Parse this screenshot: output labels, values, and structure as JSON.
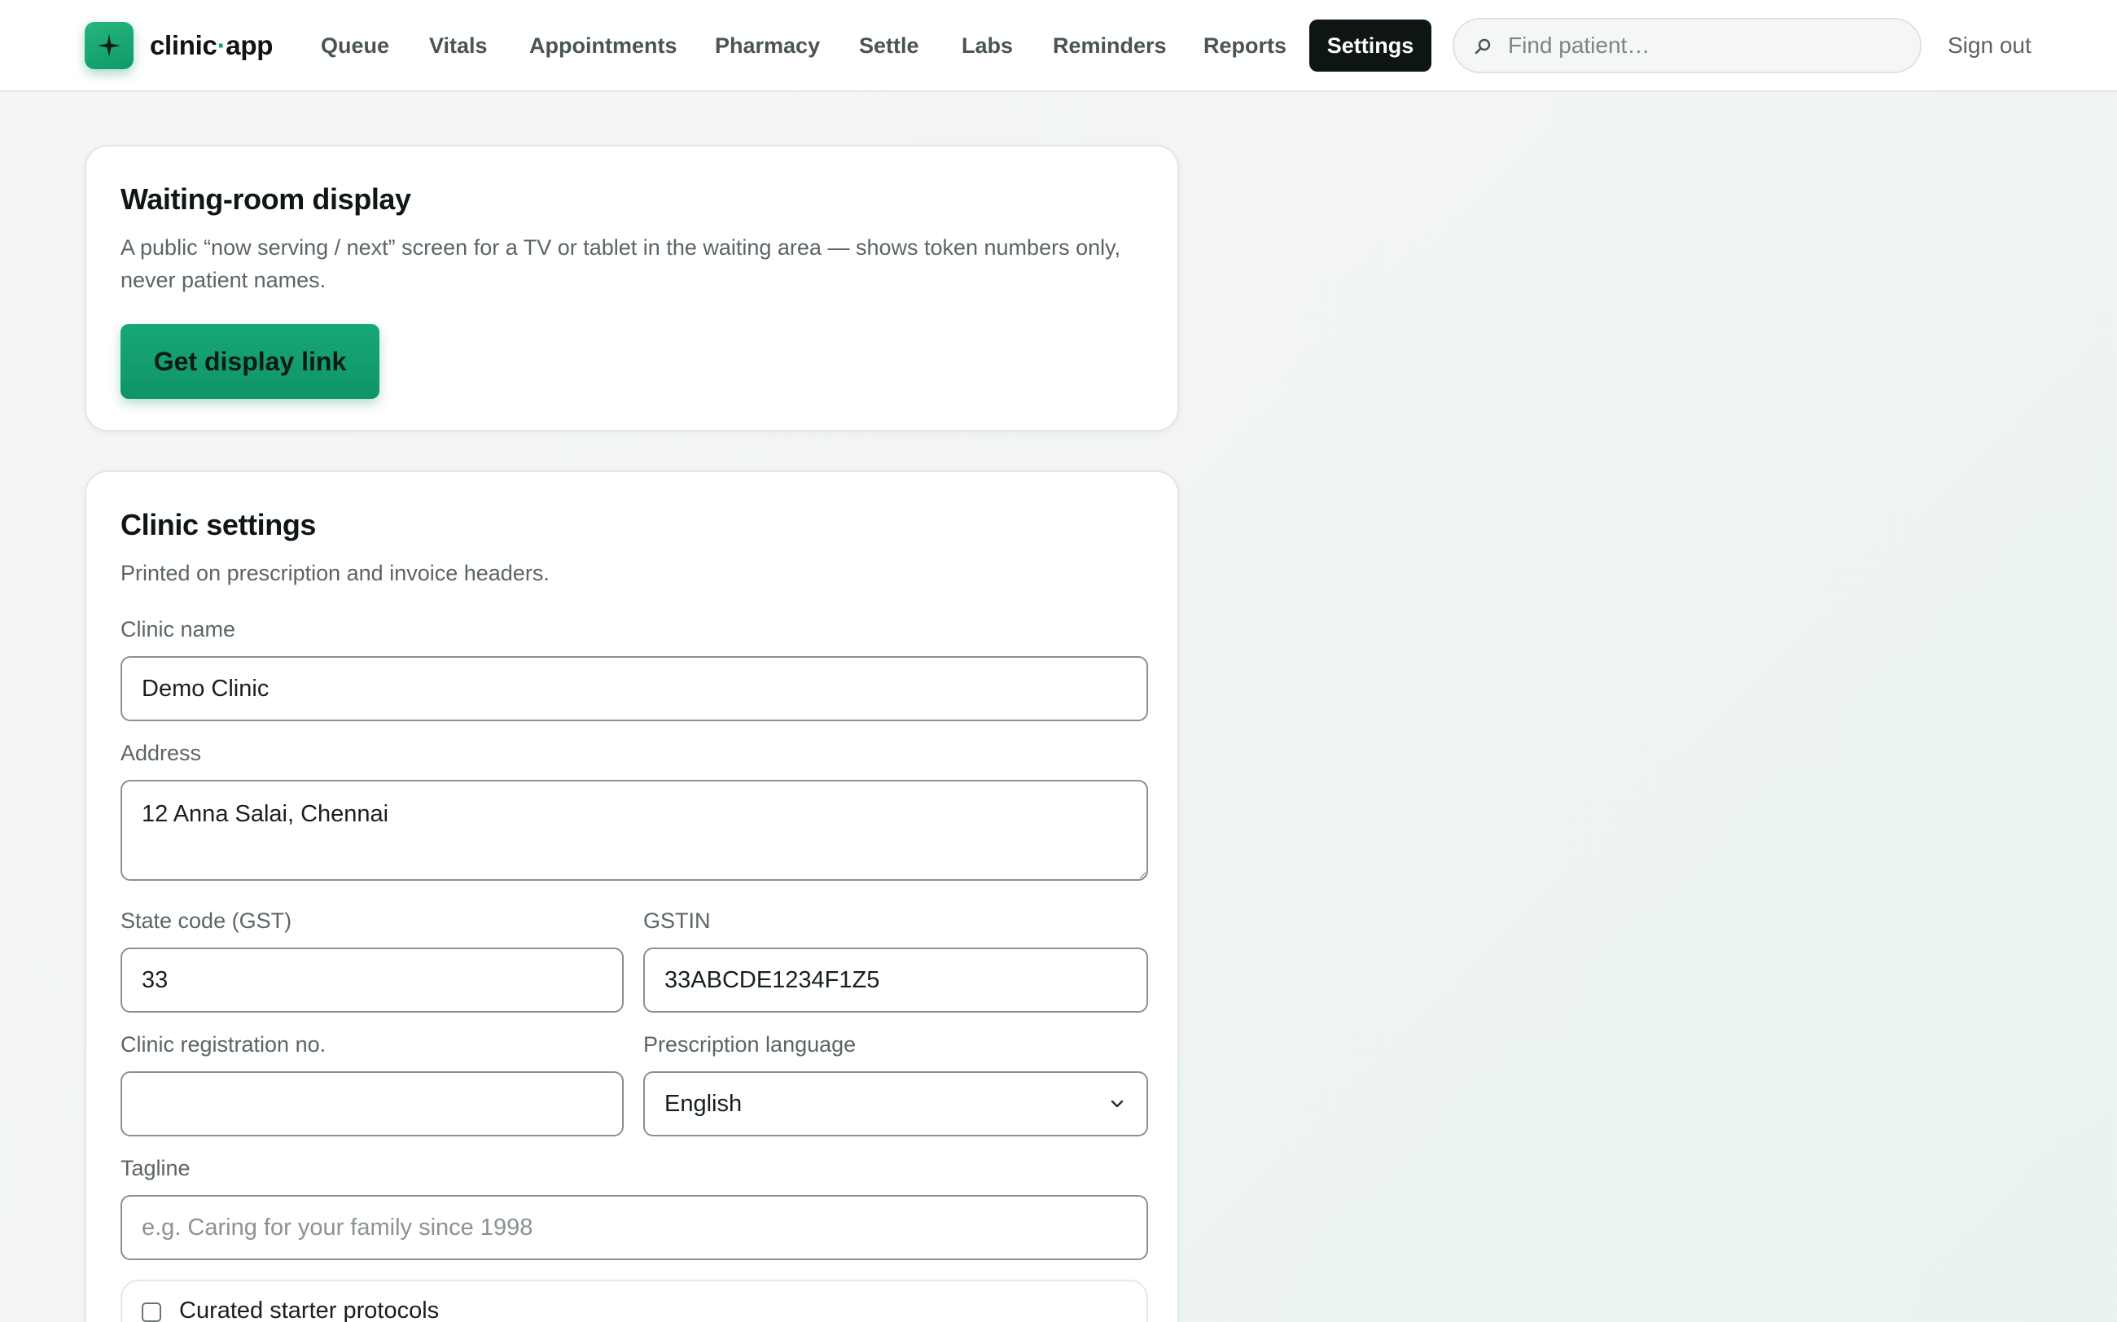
{
  "brand": {
    "name_a": "clinic",
    "name_dot": "·",
    "name_b": "app"
  },
  "nav": {
    "items": [
      "Queue",
      "Vitals",
      "Appointments",
      "Pharmacy",
      "Settle",
      "Labs",
      "Reminders",
      "Reports"
    ],
    "active": "Settings",
    "search_placeholder": "Find patient…",
    "signout": "Sign out"
  },
  "display_card": {
    "title": "Waiting-room display",
    "description": "A public “now serving / next” screen for a TV or tablet in the waiting area — shows token numbers only, never patient names.",
    "button": "Get display link"
  },
  "clinic_card": {
    "title": "Clinic settings",
    "description": "Printed on prescription and invoice headers.",
    "clinic_name": {
      "label": "Clinic name",
      "value": "Demo Clinic"
    },
    "address": {
      "label": "Address",
      "value": "12 Anna Salai, Chennai"
    },
    "state_code": {
      "label": "State code (GST)",
      "value": "33"
    },
    "gstin": {
      "label": "GSTIN",
      "value": "33ABCDE1234F1Z5"
    },
    "registration": {
      "label": "Clinic registration no.",
      "value": ""
    },
    "language": {
      "label": "Prescription language",
      "value": "English"
    },
    "tagline": {
      "label": "Tagline",
      "value": "",
      "placeholder": "e.g. Caring for your family since 1998"
    },
    "protocols": {
      "label": "Curated starter protocols",
      "checked": false
    }
  },
  "colors": {
    "accent": "#13a070",
    "button": "#0f9466",
    "nav_active_bg": "#0d1613"
  },
  "icons": {
    "logo": "sparkle-icon",
    "search": "search-icon",
    "select": "chevron-down-icon"
  }
}
